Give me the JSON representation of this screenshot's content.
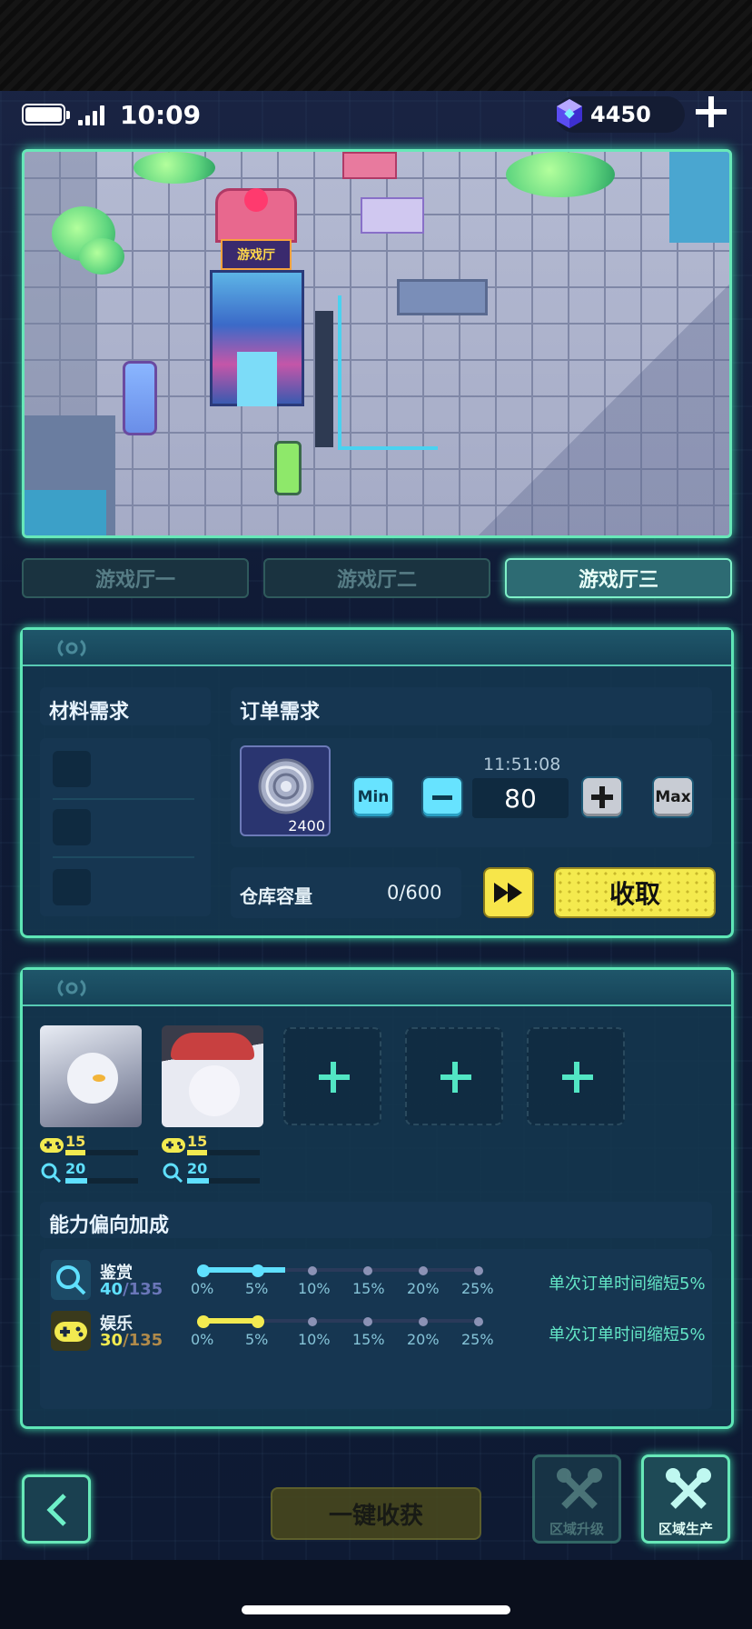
{
  "status_bar": {
    "time": "10:09",
    "gems": "4450"
  },
  "tabs": [
    {
      "label": "游戏厅一",
      "active": false
    },
    {
      "label": "游戏厅二",
      "active": false
    },
    {
      "label": "游戏厅三",
      "active": true
    }
  ],
  "map": {
    "sign": "游戏厅"
  },
  "production": {
    "material_title": "材料需求",
    "order_title": "订单需求",
    "item_count": "2400",
    "timer": "11:51:08",
    "quantity": "80",
    "min_label": "Min",
    "max_label": "Max",
    "warehouse_label": "仓库容量",
    "warehouse_value": "0/600",
    "collect_label": "收取"
  },
  "staff": {
    "members": [
      {
        "stat1": "15",
        "stat2": "20",
        "stat1_fill": 0.15,
        "stat2_fill": 0.2
      },
      {
        "stat1": "15",
        "stat2": "20",
        "stat1_fill": 0.15,
        "stat2_fill": 0.2
      }
    ],
    "empty_slots": 3,
    "bias_title": "能力偏向加成",
    "abilities": [
      {
        "name": "鉴赏",
        "value": "40",
        "max": "/135",
        "color": "#5fe0ff",
        "progress": 0.3,
        "ticks": [
          "0%",
          "5%",
          "10%",
          "15%",
          "20%",
          "25%"
        ],
        "bonus": "单次订单时间缩短5%"
      },
      {
        "name": "娱乐",
        "value": "30",
        "max": "/135",
        "color": "#f2ea50",
        "progress": 0.22,
        "ticks": [
          "0%",
          "5%",
          "10%",
          "15%",
          "20%",
          "25%"
        ],
        "bonus": "单次订单时间缩短5%"
      }
    ]
  },
  "bottom": {
    "harvest_all": "一键收获",
    "area_upgrade": "区域升级",
    "area_production": "区域生产"
  },
  "colors": {
    "accent": "#5ee6b6",
    "yellow": "#f4ea4e",
    "cyan": "#67e3ff"
  }
}
